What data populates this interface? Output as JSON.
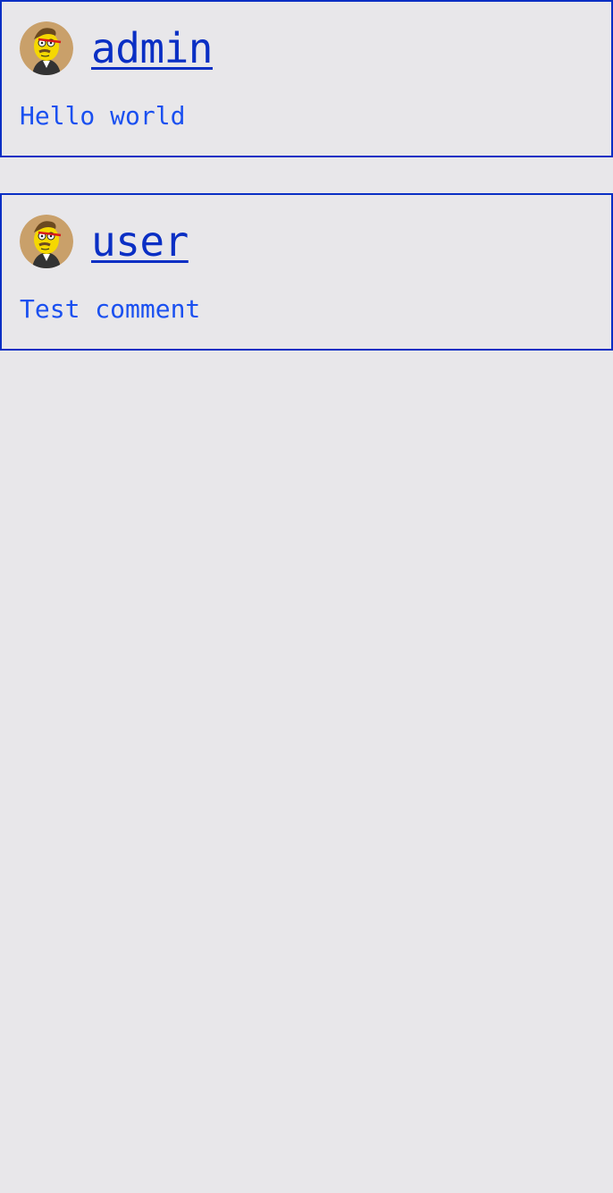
{
  "colors": {
    "background": "#e8e7ea",
    "border": "#0a2fc4",
    "username": "#0a2fc4",
    "text": "#1a50f0"
  },
  "comments": [
    {
      "avatar_icon": "cartoon-avatar-icon",
      "username": "admin",
      "text": "Hello world"
    },
    {
      "avatar_icon": "cartoon-avatar-icon",
      "username": "user",
      "text": "Test comment"
    }
  ]
}
